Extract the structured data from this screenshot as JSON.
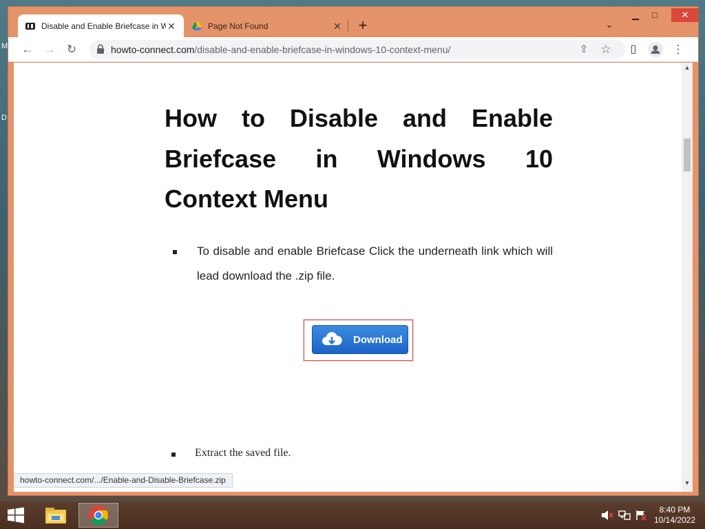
{
  "desktop": {
    "edge_letter_top": "M",
    "edge_letter_bottom": "D"
  },
  "browser": {
    "tabs": [
      {
        "title": "Disable and Enable Briefcase in W",
        "active": true,
        "favicon": "howto-connect-icon"
      },
      {
        "title": "Page Not Found",
        "active": false,
        "favicon": "google-drive-icon"
      }
    ],
    "new_tab_symbol": "+",
    "tab_search_symbol": "⌄",
    "window_buttons": {
      "minimize": "▁",
      "maximize": "□",
      "close": "✕"
    },
    "toolbar": {
      "back": "←",
      "forward": "→",
      "reload": "↻",
      "share": "⇪",
      "bookmark": "☆",
      "sidepanel": "▯",
      "menu": "⋮"
    },
    "url": {
      "host": "howto-connect.com",
      "path": "/disable-and-enable-briefcase-in-windows-10-context-menu/"
    },
    "status_url": "howto-connect.com/.../Enable-and-Disable-Briefcase.zip"
  },
  "article": {
    "title": "How to Disable and Enable Briefcase in Windows 10 Context Menu",
    "bullet1": "To disable and enable Briefcase Click the underneath link which will lead download the .zip file.",
    "download_label": "Download",
    "bullet2": "Extract the saved file."
  },
  "taskbar": {
    "time": "8:40 PM",
    "date": "10/14/2022",
    "apps": [
      "file-explorer-icon",
      "chrome-icon"
    ]
  },
  "colors": {
    "window_frame": "#e5936a",
    "close_button": "#d9493b",
    "download_button": "#1c64c8",
    "taskbar": "#4a2f21"
  }
}
